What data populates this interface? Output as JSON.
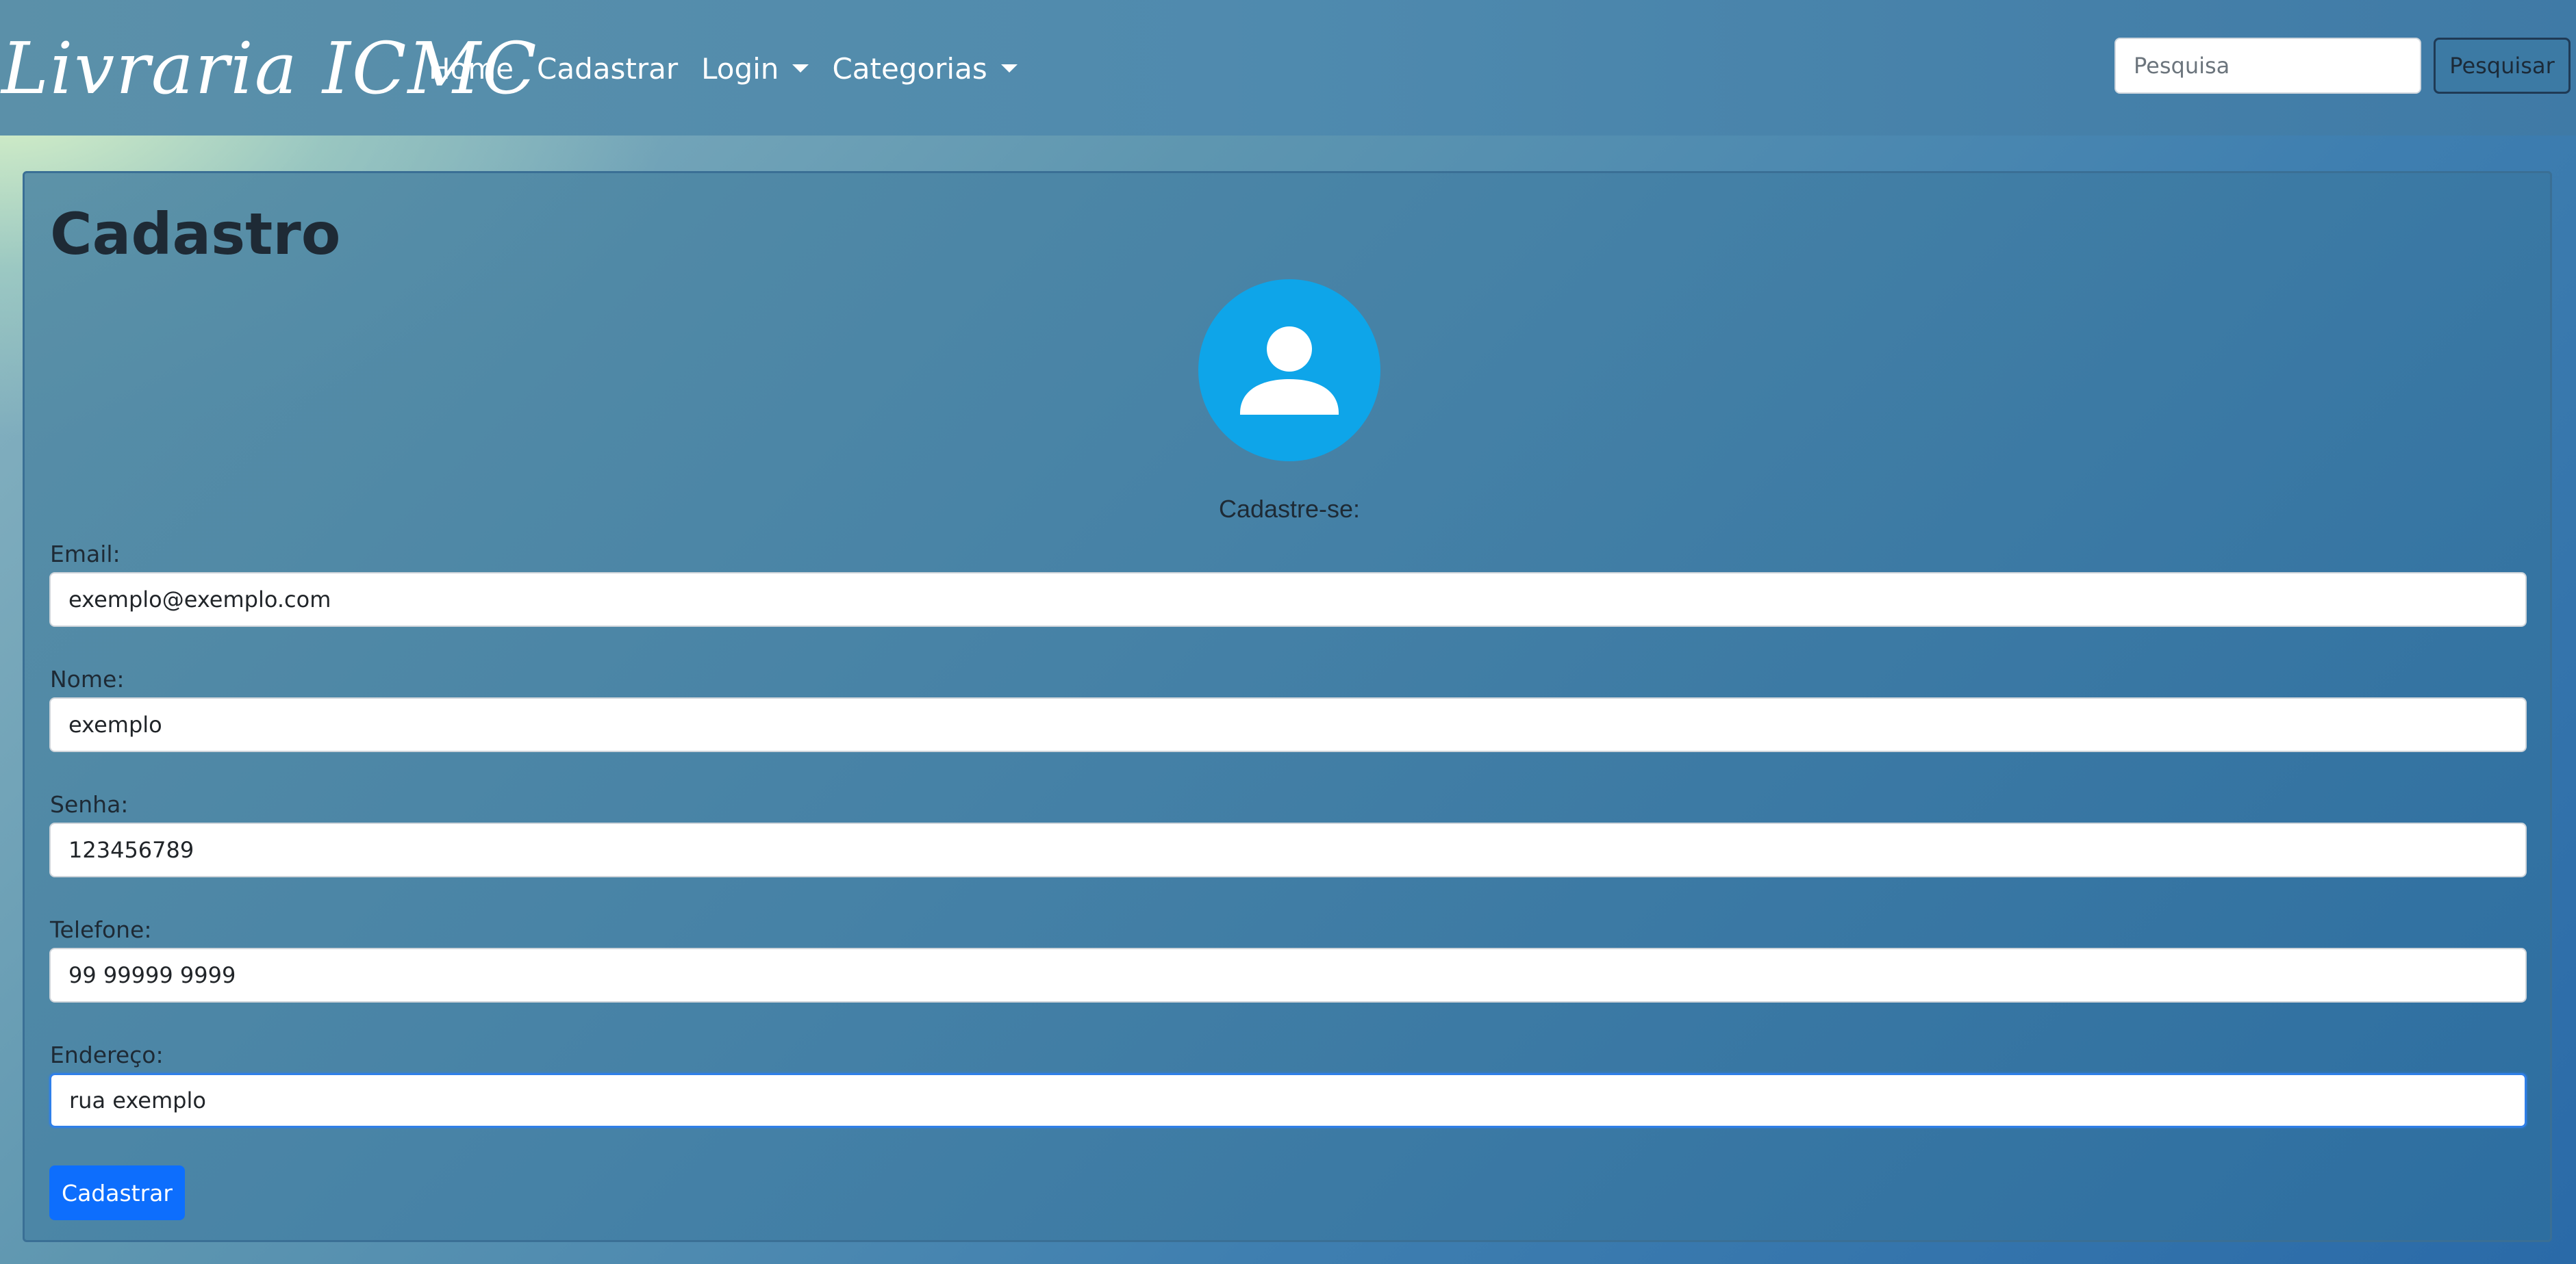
{
  "navbar": {
    "brand": "Livraria ICMC",
    "links": [
      {
        "label": "Home",
        "dropdown": false
      },
      {
        "label": "Cadastrar",
        "dropdown": false
      },
      {
        "label": "Login",
        "dropdown": true
      },
      {
        "label": "Categorias",
        "dropdown": true
      }
    ],
    "search": {
      "placeholder": "Pesquisa",
      "value": "",
      "button_label": "Pesquisar"
    }
  },
  "form": {
    "title": "Cadastro",
    "avatar_icon": "user-icon",
    "subtitle": "Cadastre-se:",
    "fields": [
      {
        "label": "Email:",
        "value": "exemplo@exemplo.com"
      },
      {
        "label": "Nome:",
        "value": "exemplo"
      },
      {
        "label": "Senha:",
        "value": "123456789"
      },
      {
        "label": "Telefone:",
        "value": "99 99999 9999"
      },
      {
        "label": "Endereço:",
        "value": "rua exemplo",
        "focused": true
      }
    ],
    "submit_label": "Cadastrar"
  },
  "colors": {
    "primary_button": "#0d6efd",
    "avatar": "#0ea5e9",
    "focus_border": "#2f7fe8"
  }
}
